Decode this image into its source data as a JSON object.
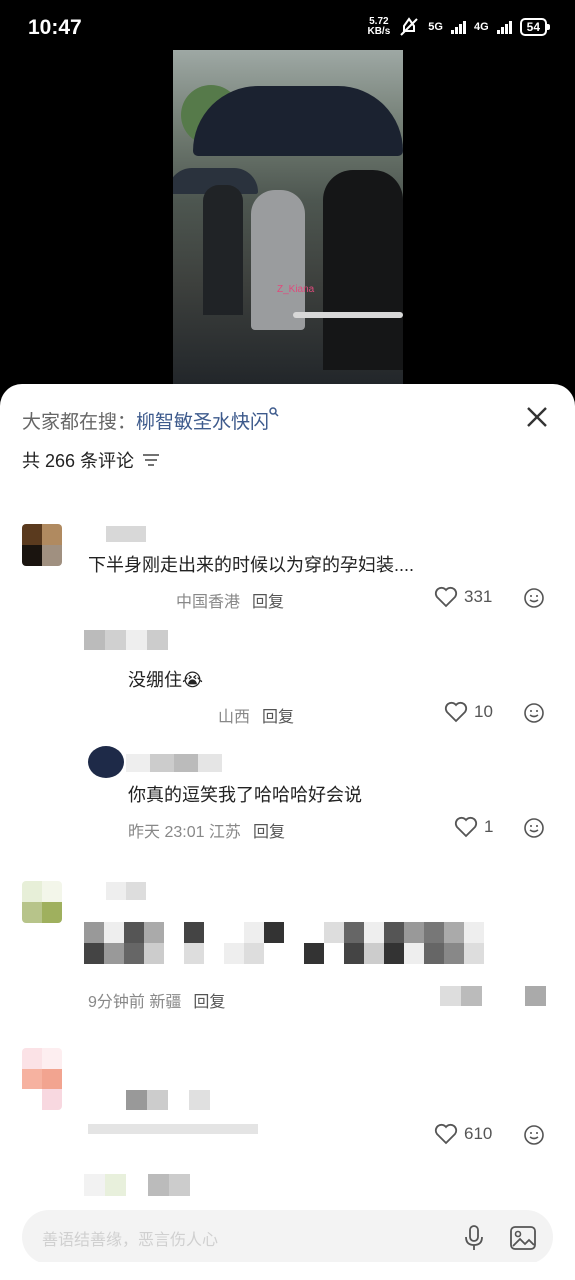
{
  "status_bar": {
    "time": "10:47",
    "net_speed_value": "5.72",
    "net_speed_unit": "KB/s",
    "sig1_label": "5G",
    "sig2_label": "4G",
    "battery": "54"
  },
  "video": {
    "watermark": "Z_Kiana"
  },
  "comments_panel": {
    "search_prefix": "大家都在搜：",
    "search_term": "柳智敏圣水快闪",
    "count_text": "共 266 条评论",
    "comments": [
      {
        "text": "下半身刚走出来的时候以为穿的孕妇装....",
        "meta": "中国香港",
        "reply": "回复",
        "likes": "331"
      },
      {
        "text": "没绷住😭",
        "meta": "山西",
        "reply": "回复",
        "likes": "10"
      },
      {
        "text": "你真的逗笑我了哈哈哈好会说",
        "meta": "昨天 23:01 江苏",
        "reply": "回复",
        "likes": "1"
      },
      {
        "meta": "9分钟前 新疆",
        "reply": "回复"
      },
      {
        "likes": "610"
      }
    ],
    "input_placeholder": "善语结善缘，恶言伤人心"
  },
  "colors": {
    "link": "#3d5a8c",
    "panel": "#ffffff",
    "input_bg": "#f3f3f3"
  },
  "icons": [
    "close-icon",
    "filter-icon",
    "heart-icon",
    "emoji-icon",
    "mic-icon",
    "image-icon"
  ]
}
